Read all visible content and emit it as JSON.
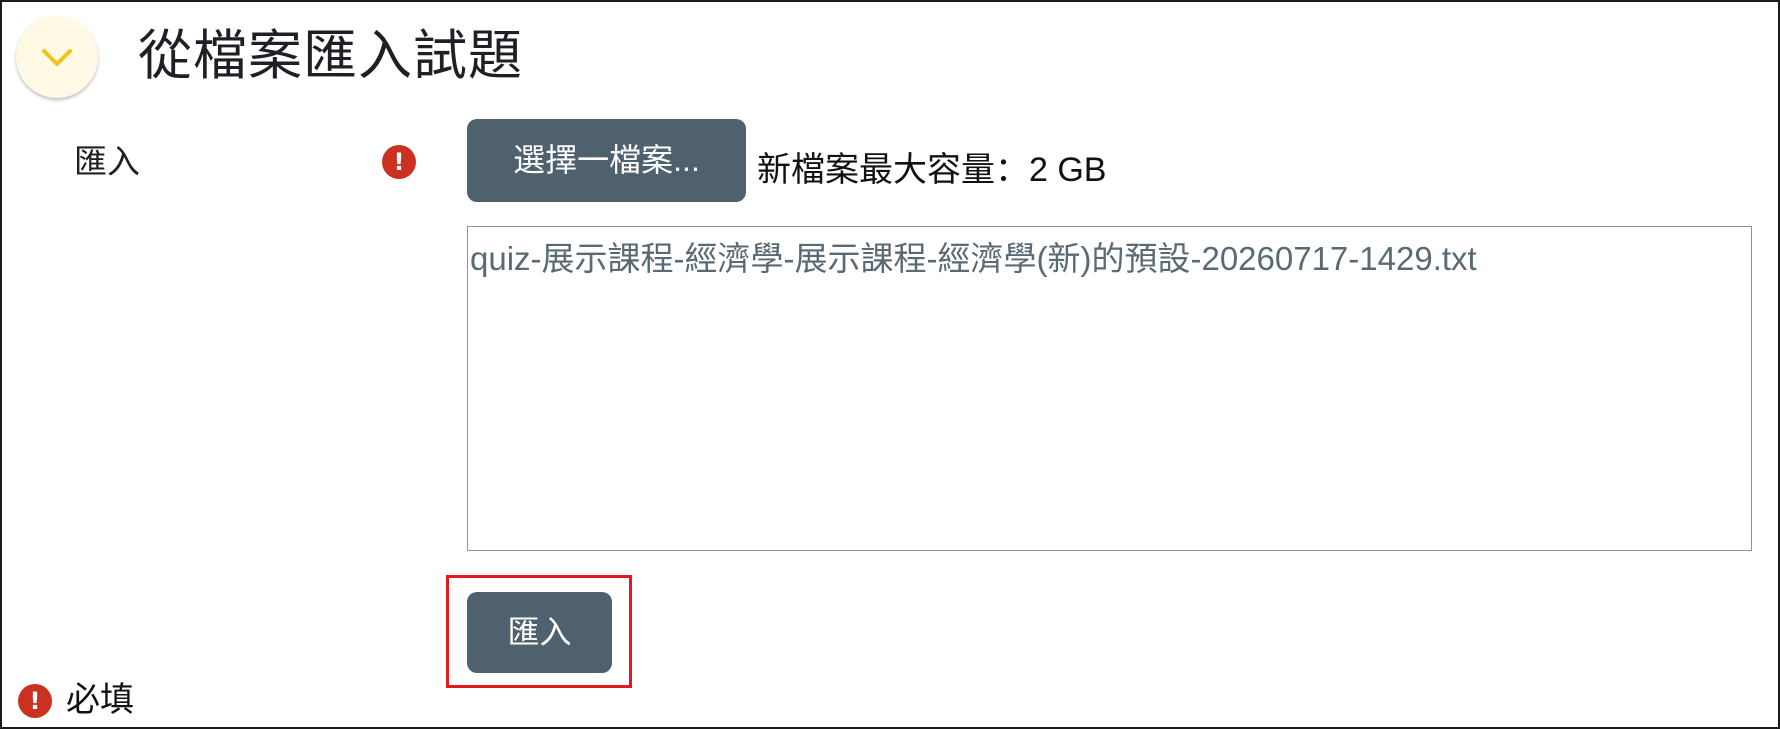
{
  "header": {
    "title": "從檔案匯入試題",
    "toggle_icon": "chevron-down-icon"
  },
  "form": {
    "field_label": "匯入",
    "required_glyph": "!",
    "choose_file_label": "選擇一檔案...",
    "max_size_text": "新檔案最大容量：2 GB",
    "file_name": "quiz-展示課程-經濟學-展示課程-經濟學(新)的預設-20260717-1429.txt",
    "import_button_label": "匯入"
  },
  "legend": {
    "required_glyph": "!",
    "required_text": "必填"
  },
  "colors": {
    "button_bg": "#4f616c",
    "required_icon": "#ca3120",
    "highlight": "#e3191f",
    "toggle_bg": "#fff9e6",
    "chevron": "#f0c419"
  }
}
